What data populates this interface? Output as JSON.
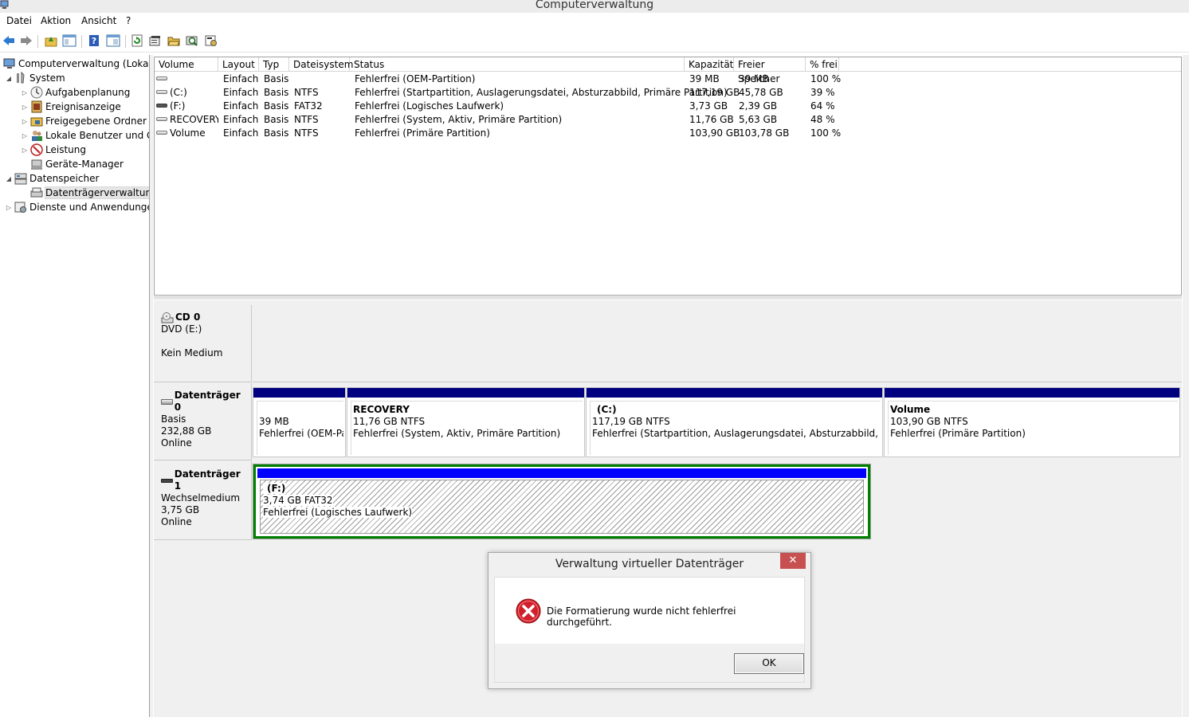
{
  "window": {
    "title": "Computerverwaltung"
  },
  "menu": [
    "Datei",
    "Aktion",
    "Ansicht",
    "?"
  ],
  "toolbar": {
    "icons": [
      "back-arrow-icon",
      "forward-arrow-icon",
      "up-folder-icon",
      "show-hide-tree-icon",
      "help-icon",
      "properties-view-icon",
      "refresh-icon",
      "properties-icon",
      "open-folder-icon",
      "search-disk-icon",
      "settings-disk-icon"
    ]
  },
  "tree": {
    "root": "Computerverwaltung (Lokal)",
    "system": "System",
    "aufgaben": "Aufgabenplanung",
    "ereignis": "Ereignisanzeige",
    "freigegeben": "Freigegebene Ordner",
    "lokale": "Lokale Benutzer und Gruppen",
    "leistung": "Leistung",
    "geraete": "Geräte-Manager",
    "datenspeicher": "Datenspeicher",
    "datentraeger": "Datenträgerverwaltung",
    "dienste": "Dienste und Anwendungen"
  },
  "list": {
    "headers": [
      "Volume",
      "Layout",
      "Typ",
      "Dateisystem",
      "Status",
      "Kapazität",
      "Freier Speicher",
      "% frei"
    ],
    "rows": [
      [
        "",
        "Einfach",
        "Basis",
        "",
        "Fehlerfrei (OEM-Partition)",
        "39 MB",
        "39 MB",
        "100 %"
      ],
      [
        "(C:)",
        "Einfach",
        "Basis",
        "NTFS",
        "Fehlerfrei (Startpartition, Auslagerungsdatei, Absturzabbild, Primäre Partition)",
        "117,19 GB",
        "45,78 GB",
        "39 %"
      ],
      [
        "(F:)",
        "Einfach",
        "Basis",
        "FAT32",
        "Fehlerfrei (Logisches Laufwerk)",
        "3,73 GB",
        "2,39 GB",
        "64 %"
      ],
      [
        "RECOVERY",
        "Einfach",
        "Basis",
        "NTFS",
        "Fehlerfrei (System, Aktiv, Primäre Partition)",
        "11,76 GB",
        "5,63 GB",
        "48 %"
      ],
      [
        "Volume",
        "Einfach",
        "Basis",
        "NTFS",
        "Fehlerfrei (Primäre Partition)",
        "103,90 GB",
        "103,78 GB",
        "100 %"
      ]
    ]
  },
  "disks": {
    "cd0": {
      "name": "CD 0",
      "line1": "DVD (E:)",
      "line2": "Kein Medium"
    },
    "disk0": {
      "name": "Datenträger 0",
      "type": "Basis",
      "size": "232,88 GB",
      "state": "Online",
      "partitions": [
        {
          "title": "",
          "size": "39 MB",
          "status": "Fehlerfrei (OEM-Partition)"
        },
        {
          "title": "RECOVERY",
          "size": "11,76 GB NTFS",
          "status": "Fehlerfrei (System, Aktiv, Primäre Partition)"
        },
        {
          "title": "(C:)",
          "size": "117,19 GB NTFS",
          "status": "Fehlerfrei (Startpartition, Auslagerungsdatei, Absturzabbild, Primäre Partition)"
        },
        {
          "title": "Volume",
          "size": "103,90 GB NTFS",
          "status": "Fehlerfrei (Primäre Partition)"
        }
      ]
    },
    "disk1": {
      "name": "Datenträger 1",
      "type": "Wechselmedium",
      "size": "3,75 GB",
      "state": "Online",
      "partition": {
        "title": "(F:)",
        "size": "3,74 GB FAT32",
        "status": "Fehlerfrei (Logisches Laufwerk)"
      }
    }
  },
  "dialog": {
    "title": "Verwaltung virtueller Datenträger",
    "close": "✕",
    "message": "Die Formatierung wurde nicht fehlerfrei durchgeführt.",
    "ok": "OK"
  },
  "colors": {
    "primary_partition": "#000080",
    "logical_drive": "#0000ff",
    "selected_border": "#008000",
    "close_button": "#c75050",
    "error_icon": "#d0202a"
  }
}
